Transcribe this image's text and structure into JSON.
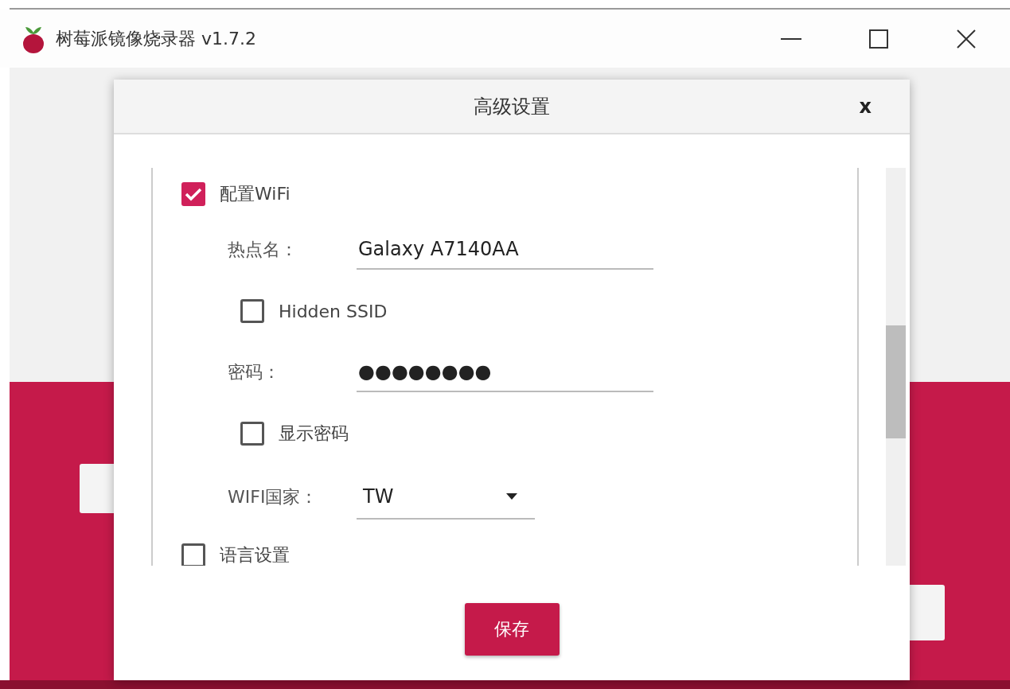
{
  "window": {
    "title": "树莓派镜像烧录器 v1.7.2"
  },
  "dialog": {
    "title": "高级设置",
    "close": "x",
    "options": [
      {
        "kind": "checkbox",
        "label": "配置WiFi",
        "checked": true,
        "children": [
          {
            "kind": "field",
            "label": "热点名：",
            "value": "Galaxy A7140AA"
          },
          {
            "kind": "checkbox",
            "label": "Hidden SSID",
            "checked": false
          },
          {
            "kind": "field",
            "label": "密码：",
            "value": "●●●●●●●●"
          },
          {
            "kind": "checkbox",
            "label": "显示密码",
            "checked": false
          },
          {
            "kind": "select",
            "label": "WIFI国家：",
            "value": "TW"
          }
        ]
      },
      {
        "kind": "checkbox",
        "label": "语言设置",
        "checked": false
      }
    ],
    "save": "保存"
  }
}
